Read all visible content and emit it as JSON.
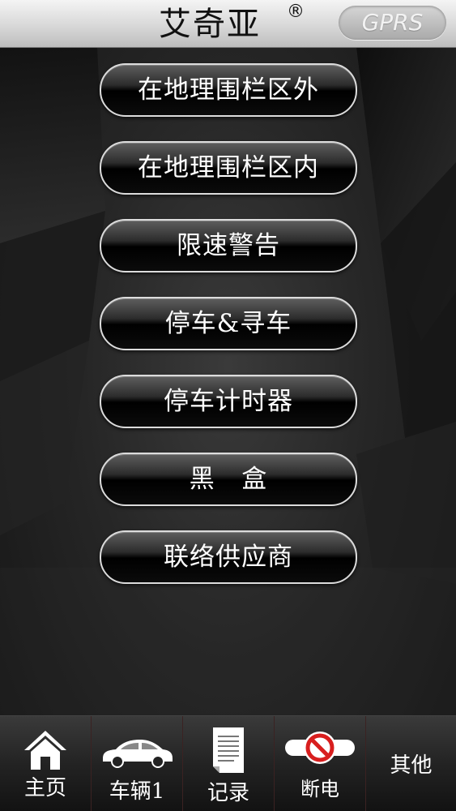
{
  "header": {
    "brand": "艾奇亚",
    "registered_mark": "®",
    "mode": "GPRS"
  },
  "menu": {
    "items": [
      {
        "label": "在地理围栏区外"
      },
      {
        "label": "在地理围栏区内"
      },
      {
        "label": "限速警告"
      },
      {
        "label": "停车&寻车"
      },
      {
        "label": "停车计时器"
      },
      {
        "label": "黑   盒"
      },
      {
        "label": "联络供应商"
      }
    ]
  },
  "tabbar": {
    "tabs": [
      {
        "label": "主页",
        "icon": "home-icon"
      },
      {
        "label": "车辆1",
        "icon": "car-icon"
      },
      {
        "label": "记录",
        "icon": "document-icon"
      },
      {
        "label": "断电",
        "icon": "power-cut-icon"
      },
      {
        "label": "其他",
        "icon": ""
      }
    ]
  },
  "colors": {
    "header_bg": "#d8d8d8",
    "button_bg": "#000000",
    "button_border": "#dcdcdc",
    "cut_red": "#d81e1e"
  }
}
